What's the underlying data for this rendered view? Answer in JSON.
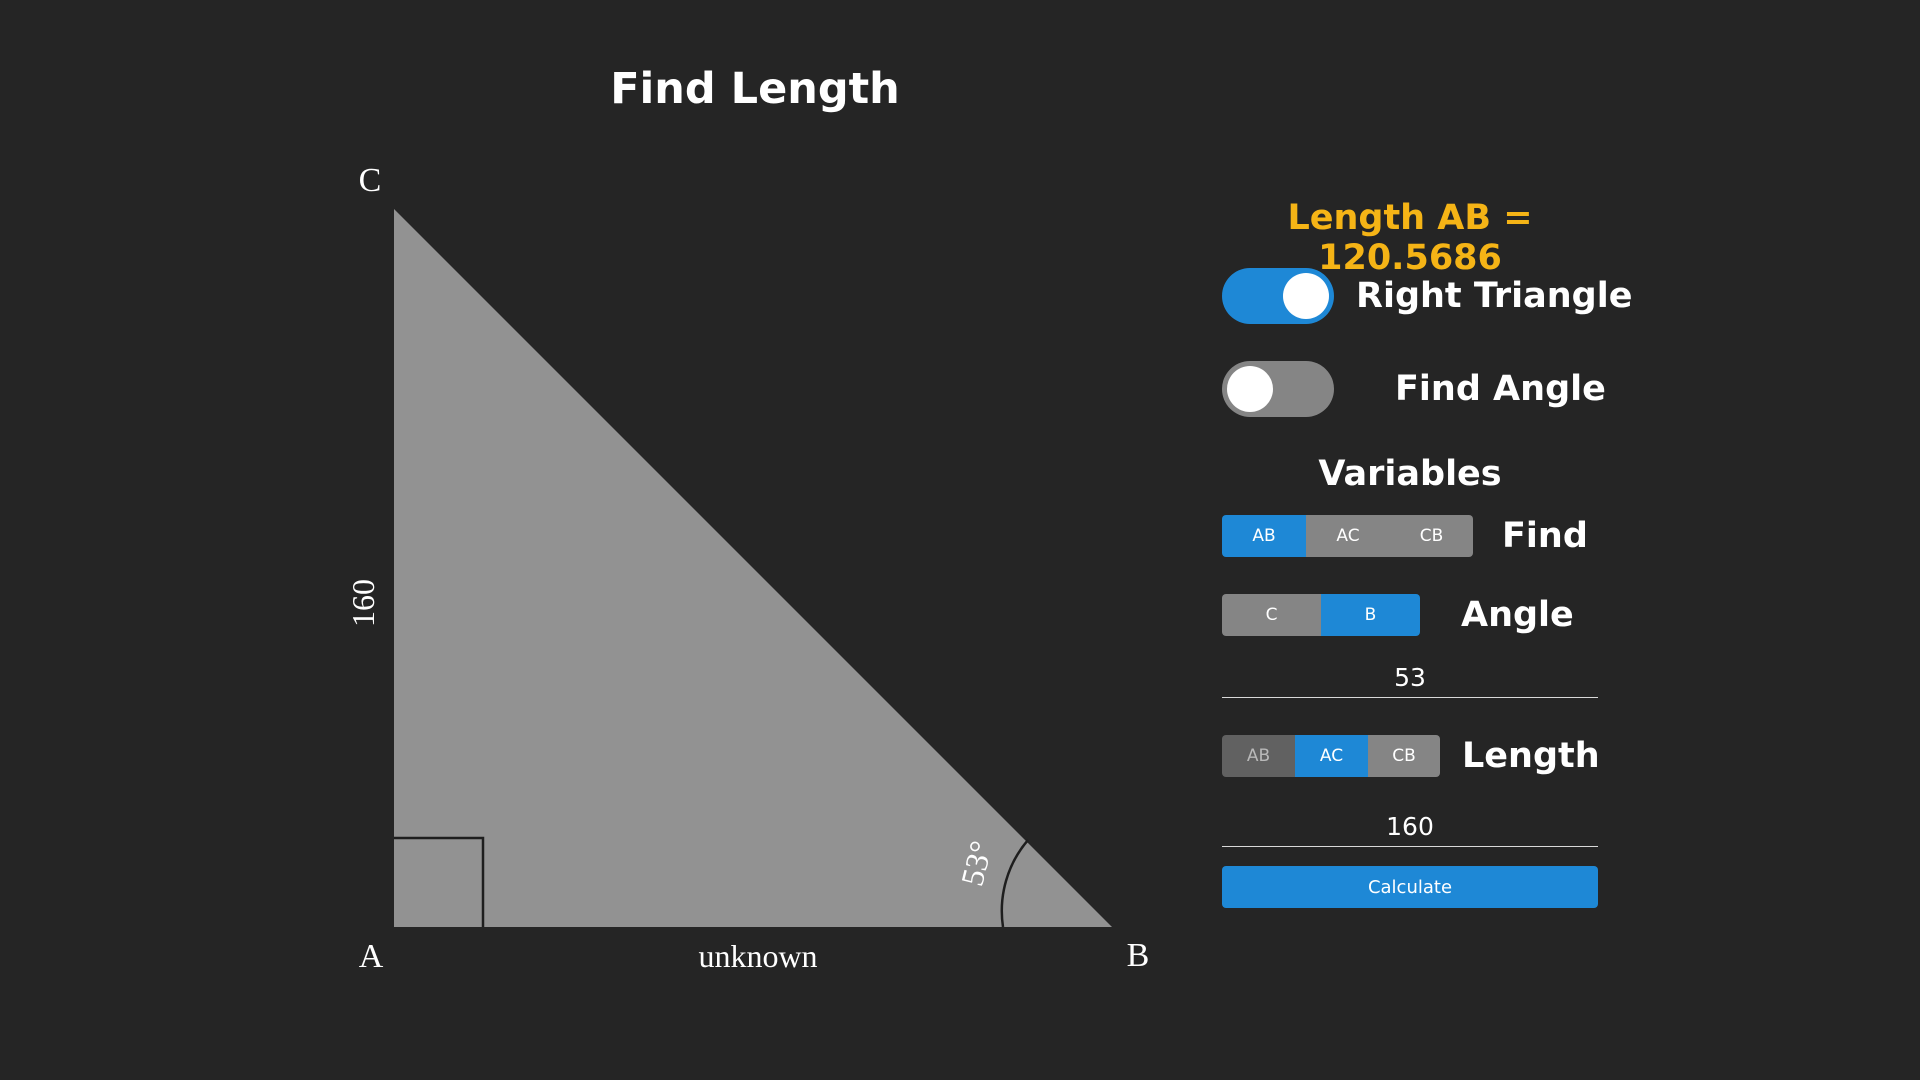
{
  "page_title": "Find Length",
  "diagram": {
    "vertices": {
      "a": "A",
      "b": "B",
      "c": "C"
    },
    "side_ac": "160",
    "side_ab": "unknown",
    "angle_b": "53°",
    "colors": {
      "fill": "#929292",
      "stroke": "#1e1e1e"
    }
  },
  "panel": {
    "result": "Length AB = 120.5686",
    "result_color": "#f5b416",
    "toggles": [
      {
        "label": "Right Triangle",
        "on": true
      },
      {
        "label": "Find Angle",
        "on": false
      }
    ],
    "variables_title": "Variables",
    "find": {
      "label": "Find",
      "options": [
        "AB",
        "AC",
        "CB"
      ],
      "selected": "AB"
    },
    "angle": {
      "label": "Angle",
      "options": [
        "C",
        "B"
      ],
      "selected": "B",
      "value": "53"
    },
    "length": {
      "label": "Length",
      "options": [
        "AB",
        "AC",
        "CB"
      ],
      "selected": "AC",
      "disabled": "AB",
      "value": "160"
    },
    "calculate_label": "Calculate",
    "accent_color": "#1e88d6"
  }
}
